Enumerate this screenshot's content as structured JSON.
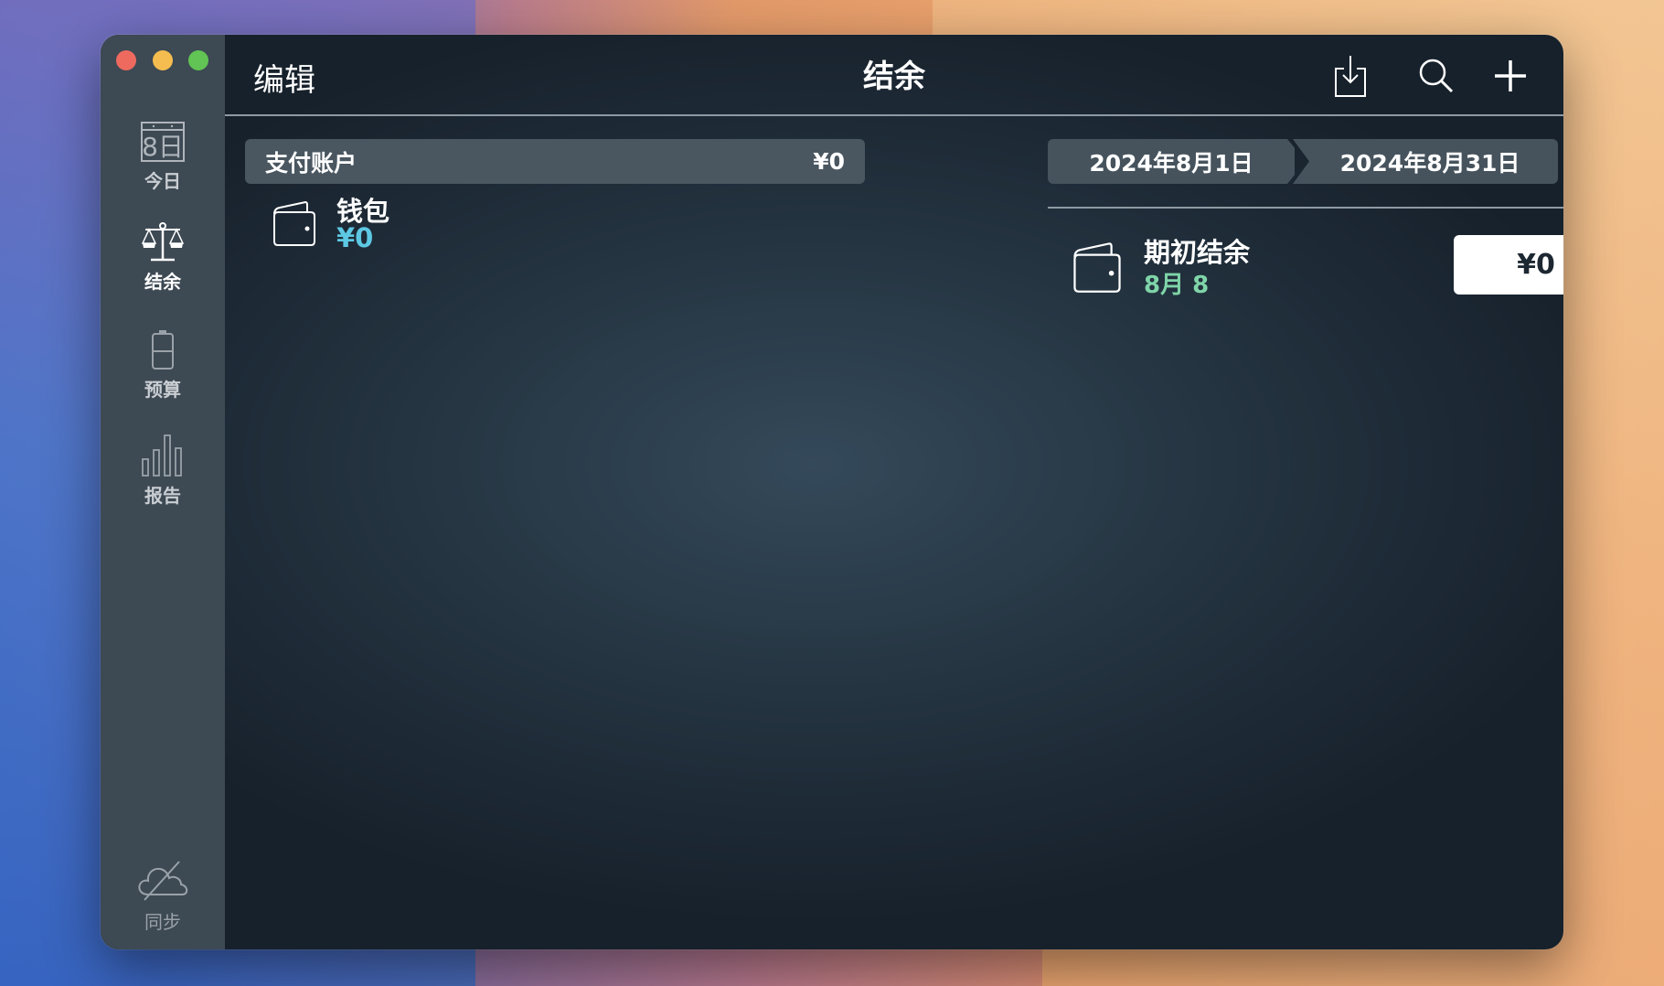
{
  "window": {
    "controls": [
      "close",
      "minimize",
      "maximize"
    ]
  },
  "sidebar": {
    "items": [
      {
        "label": "今日",
        "icon": "calendar-icon",
        "icon_text": "8日",
        "active": false
      },
      {
        "label": "结余",
        "icon": "balance-scale-icon",
        "active": true
      },
      {
        "label": "预算",
        "icon": "battery-icon",
        "active": false
      },
      {
        "label": "报告",
        "icon": "bar-chart-icon",
        "active": false
      }
    ],
    "sync": {
      "label": "同步",
      "icon": "cloud-off-icon"
    }
  },
  "header": {
    "edit_label": "编辑",
    "title": "结余",
    "actions": [
      {
        "name": "import",
        "icon": "download-icon"
      },
      {
        "name": "search",
        "icon": "search-icon"
      },
      {
        "name": "add",
        "icon": "plus-icon"
      }
    ]
  },
  "accounts": {
    "section_title": "支付账户",
    "section_total": "¥0",
    "items": [
      {
        "name": "钱包",
        "balance": "¥0",
        "icon": "wallet-icon"
      }
    ]
  },
  "period": {
    "start": "2024年8月1日",
    "end": "2024年8月31日",
    "more_label": "···"
  },
  "opening_balance": {
    "title": "期初结余",
    "date": "8月 8",
    "value": "¥0",
    "icon": "wallet-icon"
  },
  "colors": {
    "accent_blue": "#5dc8e3",
    "accent_green": "#7fd5a9",
    "sidebar_bg": "#3d4953",
    "content_bg": "#263643"
  }
}
